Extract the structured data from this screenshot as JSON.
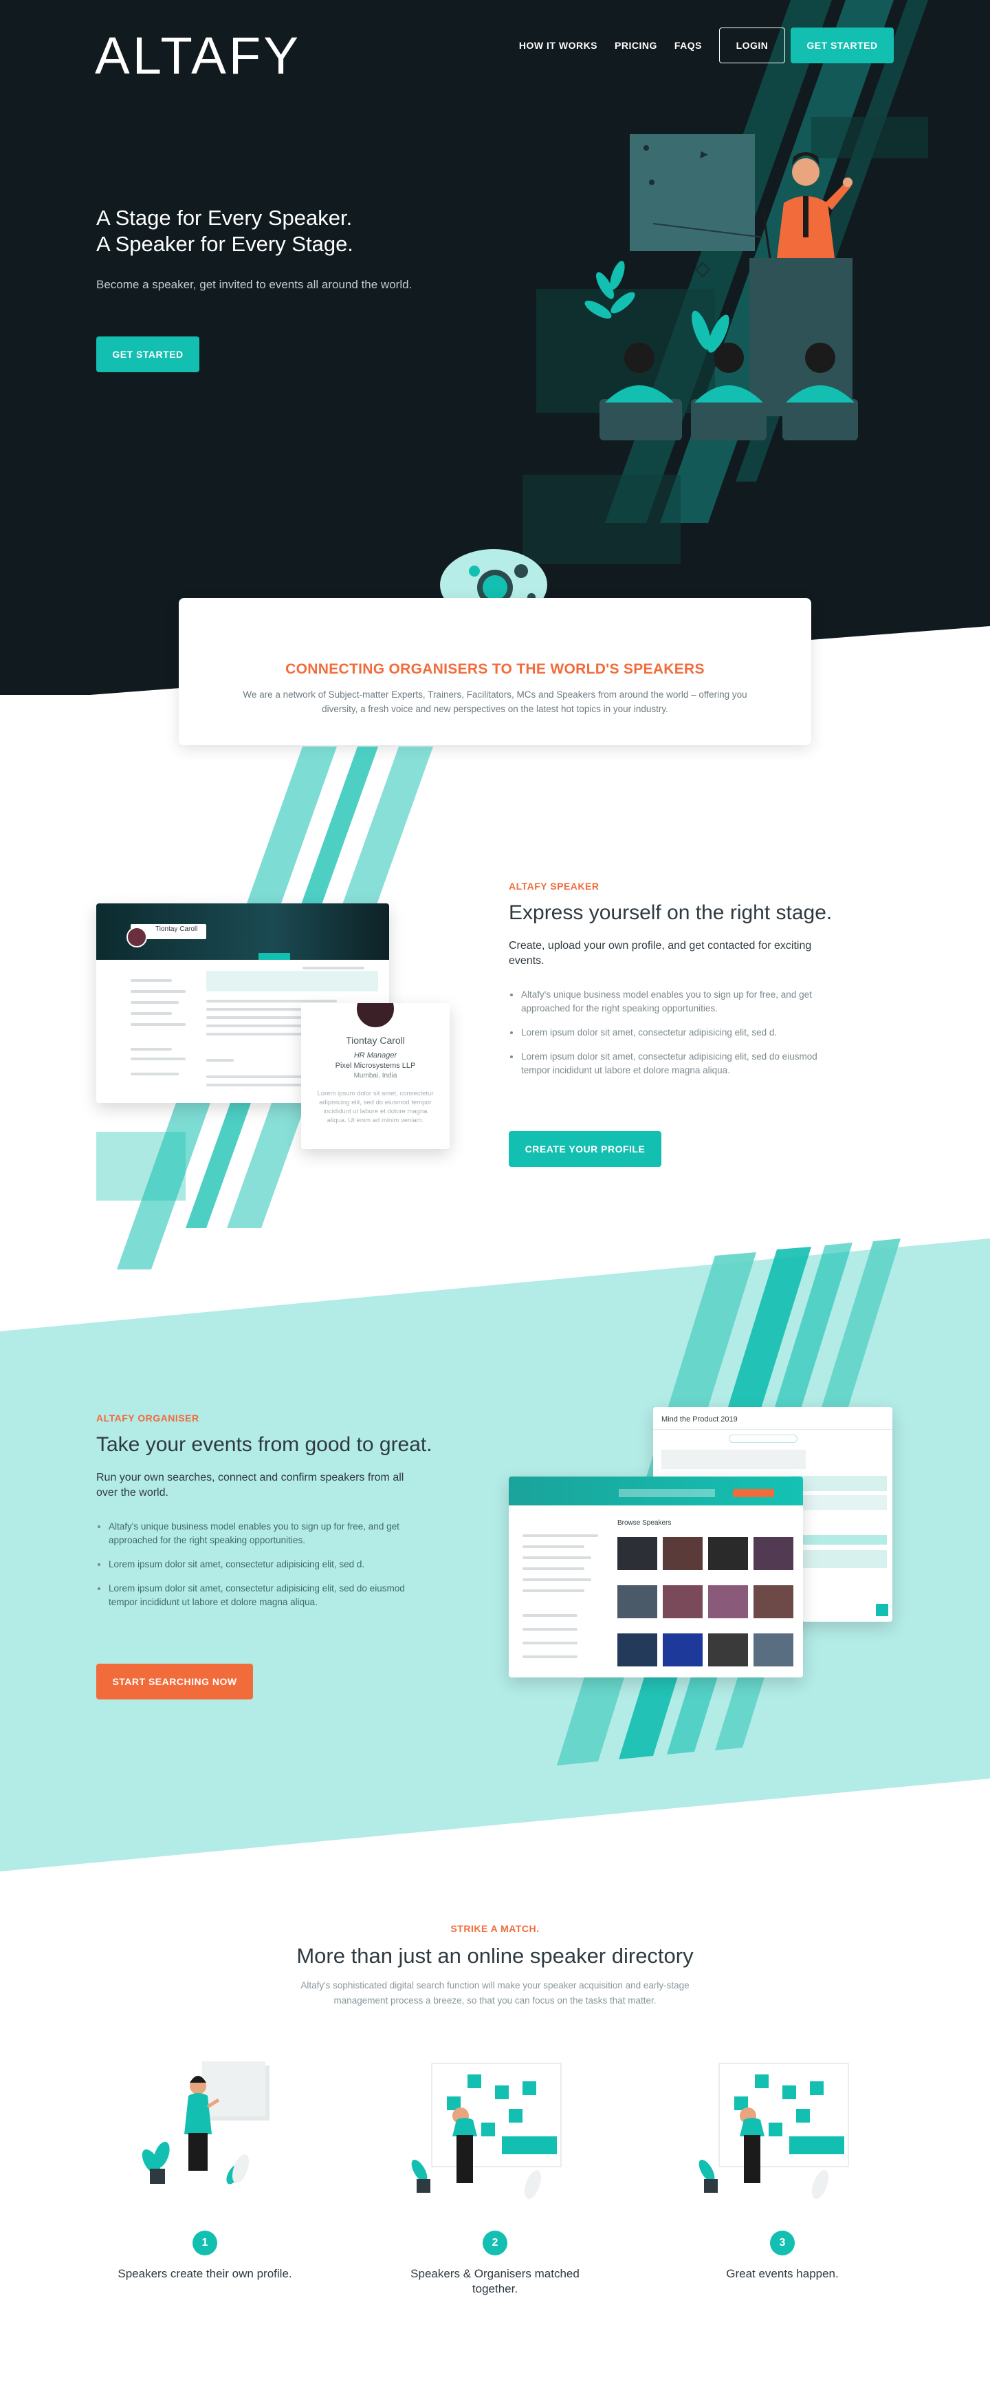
{
  "brand": {
    "logo": "ALTAFY"
  },
  "nav": {
    "links": [
      "HOW IT WORKS",
      "PRICING",
      "FAQS"
    ],
    "login": "LOGIN",
    "get_started": "GET STARTED"
  },
  "hero": {
    "title_line1": "A Stage for Every Speaker.",
    "title_line2": "A Speaker for Every Stage.",
    "subtitle": "Become a speaker, get invited to events all around the world.",
    "cta": "GET STARTED"
  },
  "intro": {
    "title": "CONNECTING ORGANISERS TO THE WORLD'S SPEAKERS",
    "text": "We are a network of Subject-matter Experts, Trainers, Facilitators, MCs and Speakers from around the world – offering you diversity, a fresh voice and new perspectives on the latest hot topics in your industry."
  },
  "speaker_section": {
    "kicker": "ALTAFY SPEAKER",
    "heading": "Express yourself on the right stage.",
    "lead": "Create, upload your own profile, and get contacted for exciting events.",
    "bullets": [
      "Altafy's unique business model enables you to sign up for free, and get approached for the right speaking opportunities.",
      "Lorem ipsum dolor sit amet, consectetur adipisicing elit, sed d.",
      "Lorem ipsum dolor sit amet, consectetur adipisicing elit, sed do eiusmod tempor incididunt ut labore et dolore magna aliqua."
    ],
    "cta": "CREATE YOUR PROFILE",
    "profile_card": {
      "name": "Tiontay Caroll",
      "role": "HR Manager",
      "company": "Pixel Microsystems LLP",
      "location": "Mumbai, India",
      "blurb": "Lorem ipsum dolor sit amet, consectetur adipisicing elit, sed do eiusmod tempor incididunt ut labore et dolore magna aliqua. Ut enim ad minim veniam."
    },
    "mock_name": "Tiontay Caroll"
  },
  "organiser_section": {
    "kicker": "ALTAFY ORGANISER",
    "heading": "Take your events from good to great.",
    "lead": "Run your own searches, connect and confirm speakers from all over the world.",
    "bullets": [
      "Altafy's unique business model enables you to sign up for free, and get approached for the right speaking opportunities.",
      "Lorem ipsum dolor sit amet, consectetur adipisicing elit, sed d.",
      "Lorem ipsum dolor sit amet, consectetur adipisicing elit, sed do eiusmod tempor incididunt ut labore et dolore magna aliqua."
    ],
    "cta": "START SEARCHING NOW",
    "chat_title": "Mind the Product 2019",
    "browse_title": "Browse Speakers"
  },
  "match_section": {
    "kicker": "STRIKE A MATCH.",
    "heading": "More than just an online speaker directory",
    "text": "Altafy's sophisticated digital search function will make your speaker acquisition and early-stage management process a breeze, so that you can focus on the tasks that matter.",
    "steps": [
      {
        "num": "1",
        "label": "Speakers create their own profile."
      },
      {
        "num": "2",
        "label": "Speakers & Organisers matched together."
      },
      {
        "num": "3",
        "label": "Great events happen."
      }
    ]
  },
  "colors": {
    "teal": "#12bfb0",
    "orange": "#f26b3a",
    "dark": "#111a1e",
    "mint": "#b3ebe6"
  }
}
